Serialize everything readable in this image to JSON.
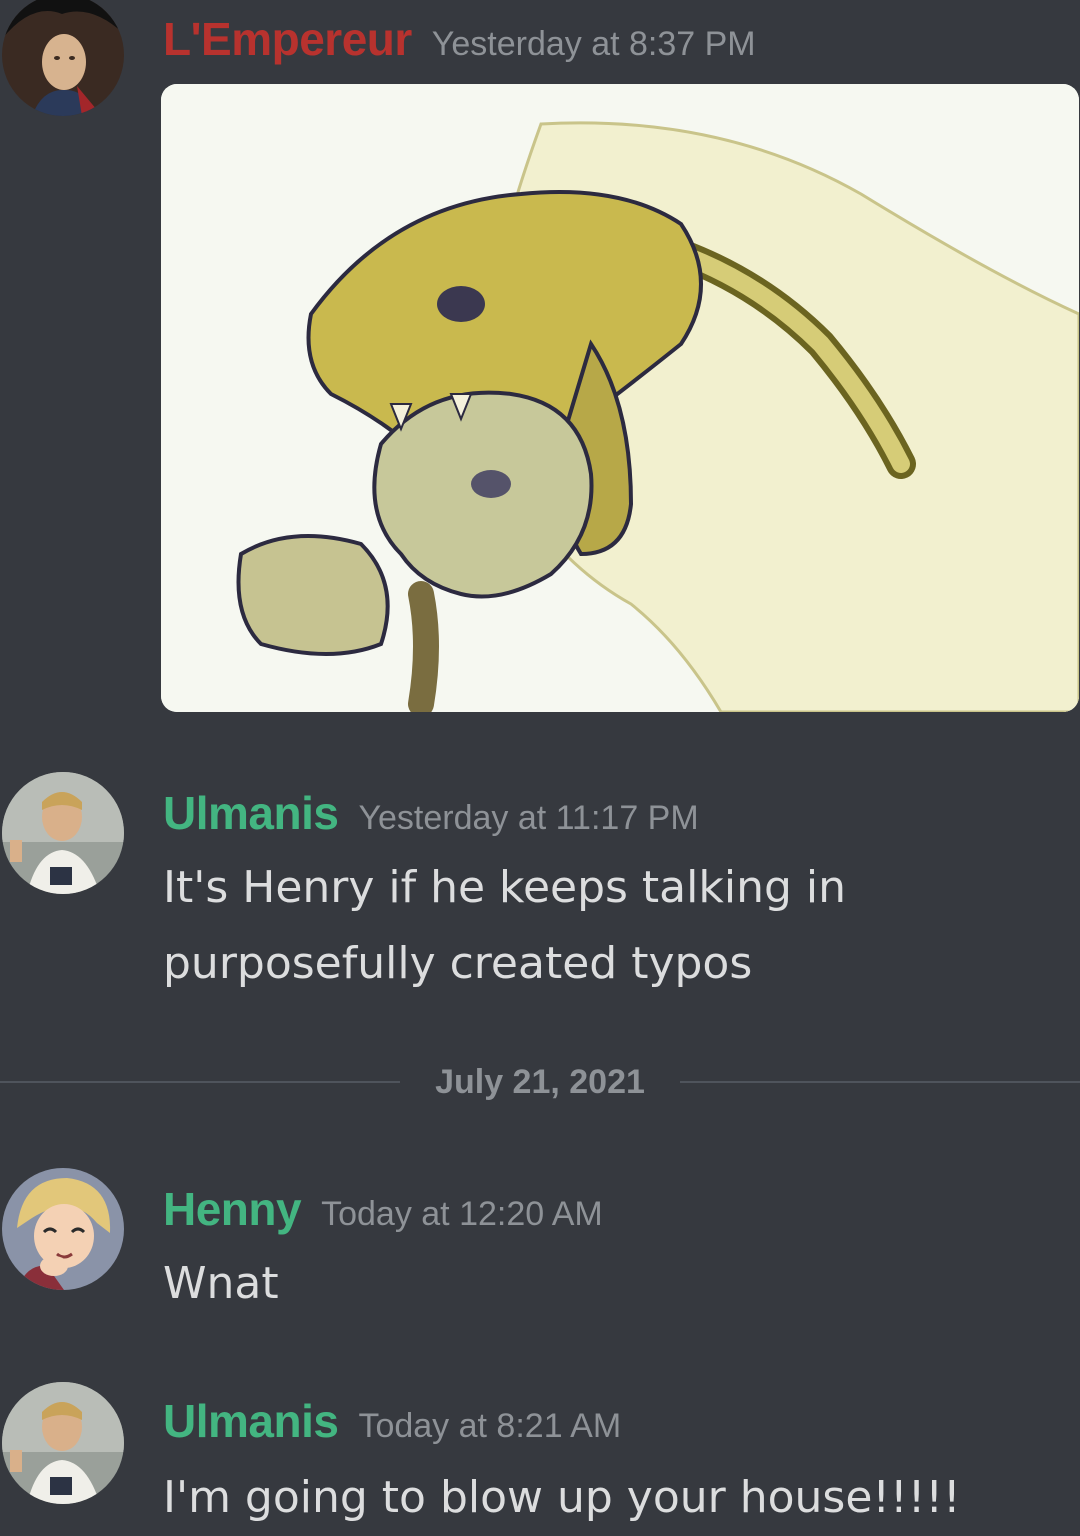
{
  "messages": [
    {
      "author": "L'Empereur",
      "author_color": "#b8322e",
      "timestamp": "Yesterday at 8:37 PM",
      "attachment": "image-attachment"
    },
    {
      "author": "Ulmanis",
      "author_color": "#43b581",
      "timestamp": "Yesterday at 11:17 PM",
      "lines": [
        "It's Henry if he keeps talking in",
        "purposefully created typos"
      ]
    },
    {
      "author": "Henny",
      "author_color": "#43b581",
      "timestamp": "Today at 12:20 AM",
      "lines": [
        "Wnat"
      ]
    },
    {
      "author": "Ulmanis",
      "author_color": "#43b581",
      "timestamp": "Today at 8:21 AM",
      "lines": [
        "I'm going to blow up your house!!!!!"
      ]
    }
  ],
  "date_divider": "July 21, 2021",
  "colors": {
    "background": "#36393f",
    "text": "#dcddde",
    "muted": "#8e9297"
  }
}
